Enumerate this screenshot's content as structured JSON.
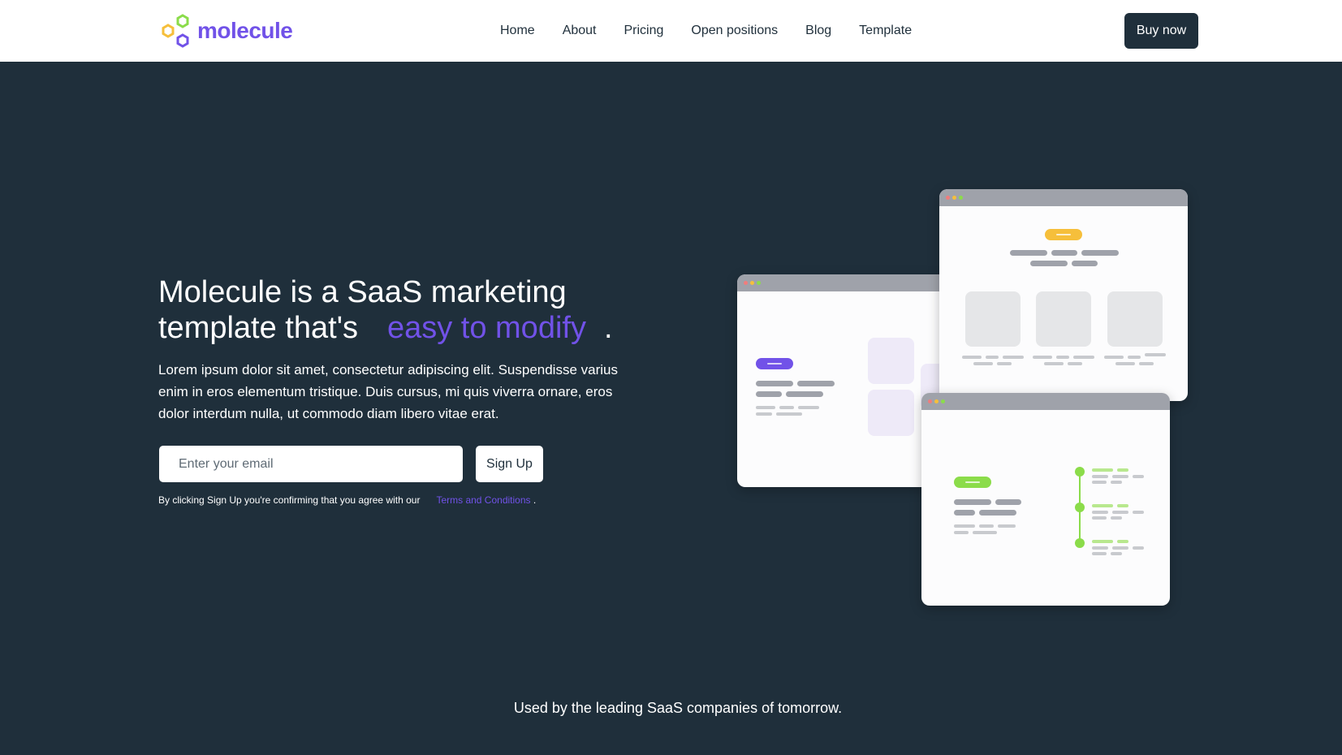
{
  "brand": {
    "name": "molecule",
    "accent": "#7152e8"
  },
  "nav": {
    "links": [
      "Home",
      "About",
      "Pricing",
      "Open positions",
      "Blog",
      "Template"
    ],
    "buy_label": "Buy now"
  },
  "hero": {
    "title_line1": "Molecule is a SaaS marketing",
    "title_line2": "template that's",
    "title_accent": "easy to modify",
    "title_end": ".",
    "description": "Lorem ipsum dolor sit amet, consectetur adipiscing elit. Suspendisse varius enim in eros elementum tristique. Duis cursus, mi quis viverra ornare, eros dolor interdum nulla, ut commodo diam libero vitae erat.",
    "email_placeholder": "Enter your email",
    "signup_label": "Sign Up",
    "terms_text": "By clicking Sign Up you're confirming that you agree with our",
    "terms_link": "Terms and Conditions",
    "terms_end": "."
  },
  "tagline": "Used by the leading SaaS companies of tomorrow.",
  "colors": {
    "background": "#1f2f3b",
    "pill_purple": "#7152e8",
    "pill_yellow": "#f6bf3b",
    "pill_green": "#8bdc4a"
  }
}
